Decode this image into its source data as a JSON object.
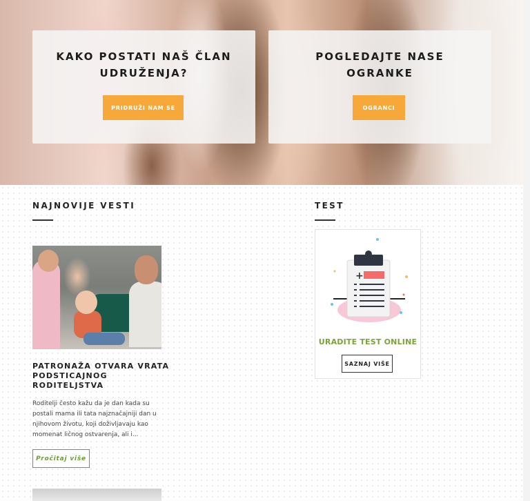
{
  "hero": {
    "cards": [
      {
        "title": "KAKO POSTATI NAŠ ČLAN UDRUŽENJA?",
        "button": "PRIDRUŽI NAM SE"
      },
      {
        "title": "POGLEDAJTE NASE OGRANKE",
        "button": "OGRANCI"
      }
    ]
  },
  "news": {
    "section_title": "NAJNOVIJE VESTI",
    "article": {
      "title": "PATRONAŽA OTVARA VRATA PODSTICAJNOG RODITELJSTVA",
      "excerpt": "Roditelji često kažu da je dan kada su postali mama ili tata najznačajniji dan u njihovom životu, koji doživljavaju kao momenat ličnog ostvarenja, ali i...",
      "read_more": "Pročitaj više"
    }
  },
  "test": {
    "section_title": "TEST",
    "heading": "URADITE TEST ONLINE",
    "button": "SAZNAJ VIŠE"
  },
  "colors": {
    "accent_orange": "#f7a83a",
    "accent_green": "#7aa33b",
    "text_dark": "#222222"
  }
}
